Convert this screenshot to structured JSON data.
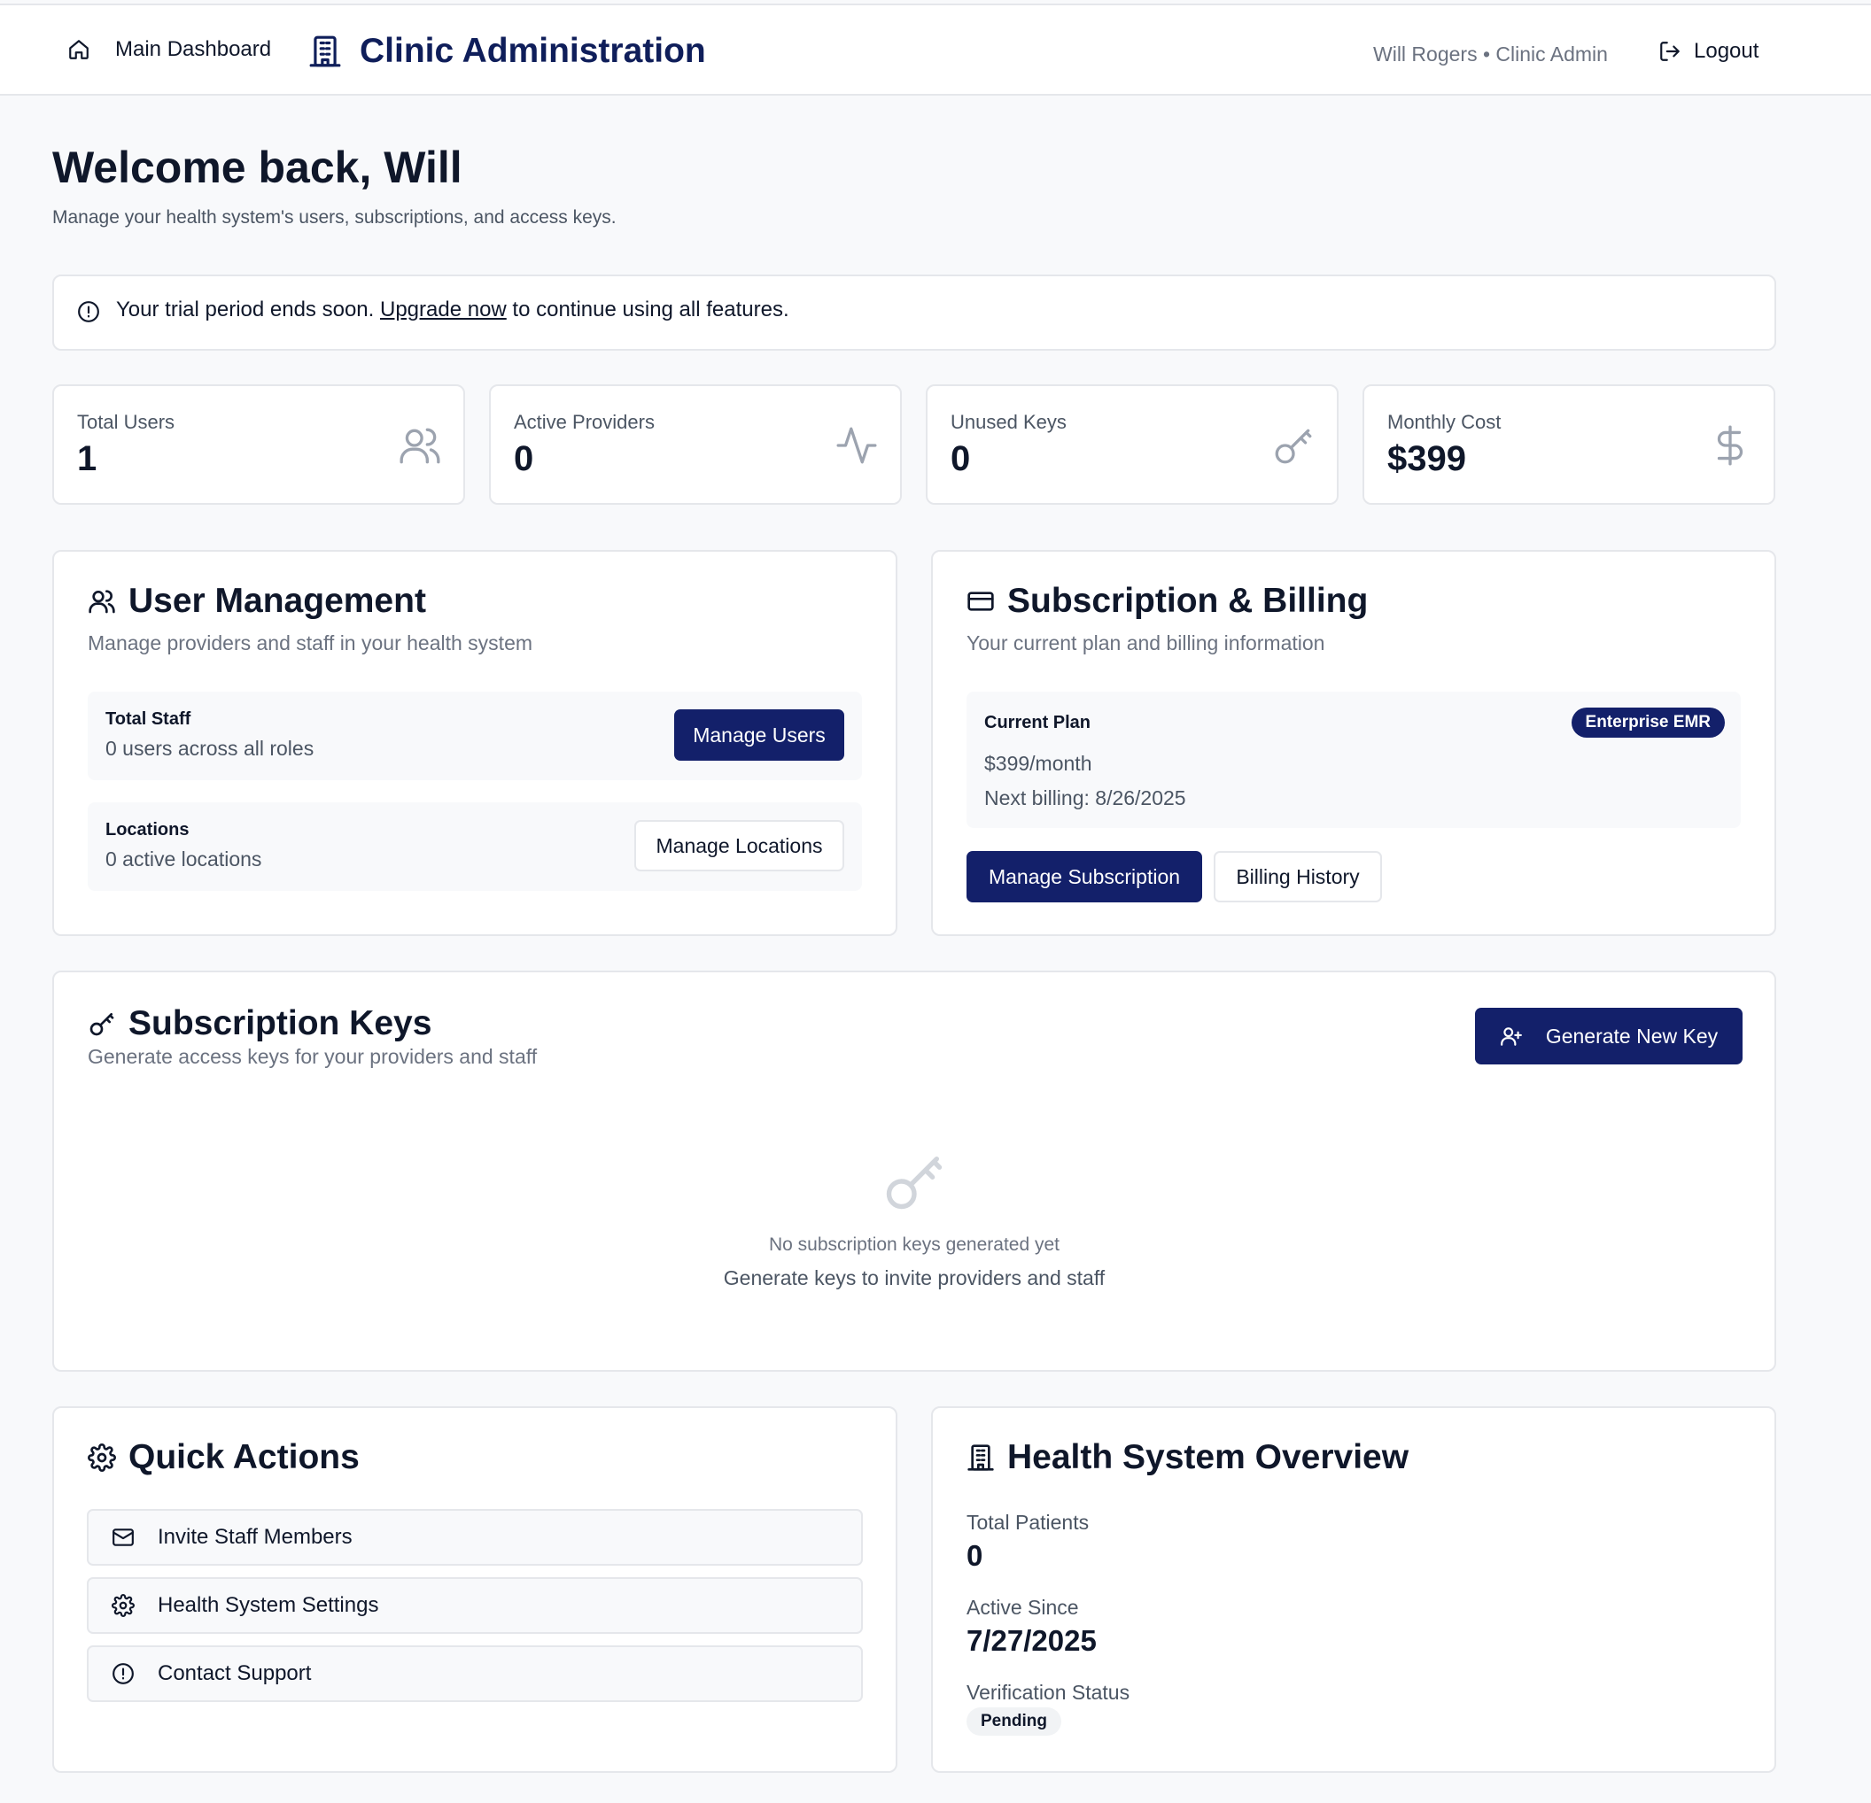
{
  "header": {
    "home_label": "Main Dashboard",
    "title": "Clinic Administration",
    "user_info": "Will Rogers • Clinic Admin",
    "logout_label": "Logout"
  },
  "welcome": {
    "title": "Welcome back, Will",
    "subtitle": "Manage your health system's users, subscriptions, and access keys."
  },
  "alert": {
    "prefix": "Your trial period ends soon.",
    "link": "Upgrade now",
    "suffix": "to continue using all features."
  },
  "stats": [
    {
      "label": "Total Users",
      "value": "1",
      "icon": "users-icon"
    },
    {
      "label": "Active Providers",
      "value": "0",
      "icon": "activity-icon"
    },
    {
      "label": "Unused Keys",
      "value": "0",
      "icon": "key-icon"
    },
    {
      "label": "Monthly Cost",
      "value": "$399",
      "icon": "dollar-icon"
    }
  ],
  "user_management": {
    "title": "User Management",
    "subtitle": "Manage providers and staff in your health system",
    "staff_title": "Total Staff",
    "staff_sub": "0 users across all roles",
    "manage_users": "Manage Users",
    "locations_title": "Locations",
    "locations_sub": "0 active locations",
    "manage_locations": "Manage Locations"
  },
  "billing": {
    "title": "Subscription & Billing",
    "subtitle": "Your current plan and billing information",
    "plan_label": "Current Plan",
    "plan_badge": "Enterprise EMR",
    "price": "$399/month",
    "next_billing": "Next billing: 8/26/2025",
    "manage_subscription": "Manage Subscription",
    "billing_history": "Billing History"
  },
  "keys": {
    "title": "Subscription Keys",
    "subtitle": "Generate access keys for your providers and staff",
    "generate": "Generate New Key",
    "empty_title": "No subscription keys generated yet",
    "empty_sub": "Generate keys to invite providers and staff"
  },
  "quick_actions": {
    "title": "Quick Actions",
    "items": [
      {
        "label": "Invite Staff Members",
        "icon": "mail-icon"
      },
      {
        "label": "Health System Settings",
        "icon": "gear-icon"
      },
      {
        "label": "Contact Support",
        "icon": "alert-circle-icon"
      }
    ]
  },
  "overview": {
    "title": "Health System Overview",
    "total_patients_label": "Total Patients",
    "total_patients": "0",
    "active_since_label": "Active Since",
    "active_since": "7/27/2025",
    "verification_label": "Verification Status",
    "verification": "Pending"
  },
  "colors": {
    "primary": "#13206a",
    "page_bg": "#f8f9fb",
    "border": "#e5e7eb",
    "muted_text": "#6b7280"
  }
}
